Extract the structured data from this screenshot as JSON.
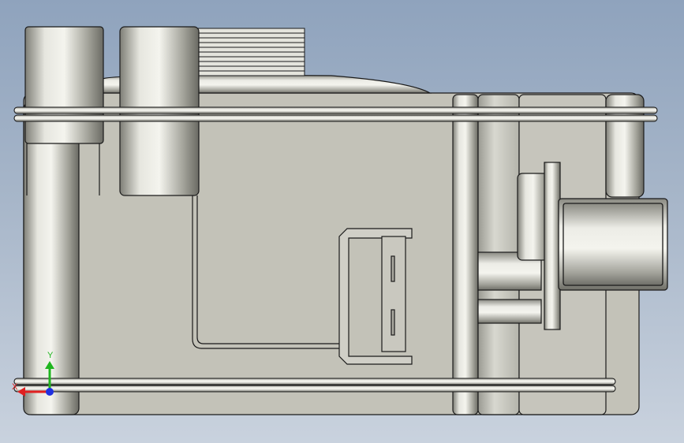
{
  "viewport": {
    "background_top": "#8fa3bd",
    "background_bottom": "#c9d2de",
    "body_color": "#c3c2b8",
    "outline_color": "#1a1a1a"
  },
  "triad": {
    "x_label": "X",
    "y_label": "Y",
    "x_color": "#e02020",
    "y_color": "#1fb51f",
    "z_color": "#2030e0"
  }
}
